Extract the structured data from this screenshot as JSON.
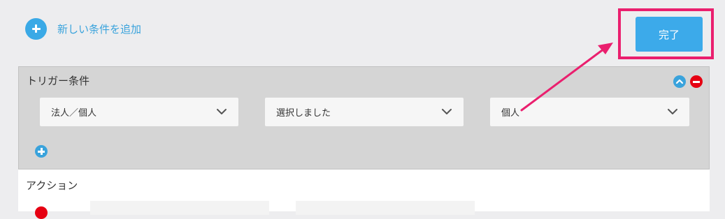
{
  "add_condition": {
    "label": "新しい条件を追加",
    "icon": "plus-circle-icon"
  },
  "done_button": {
    "label": "完了"
  },
  "colors": {
    "accent": "#3aa9e6",
    "highlight": "#ea1f6e",
    "remove": "#e60012"
  },
  "trigger": {
    "title": "トリガー条件",
    "selects": [
      {
        "value": "法人／個人"
      },
      {
        "value": "選択しました"
      },
      {
        "value": "個人"
      }
    ]
  },
  "action": {
    "title": "アクション"
  }
}
